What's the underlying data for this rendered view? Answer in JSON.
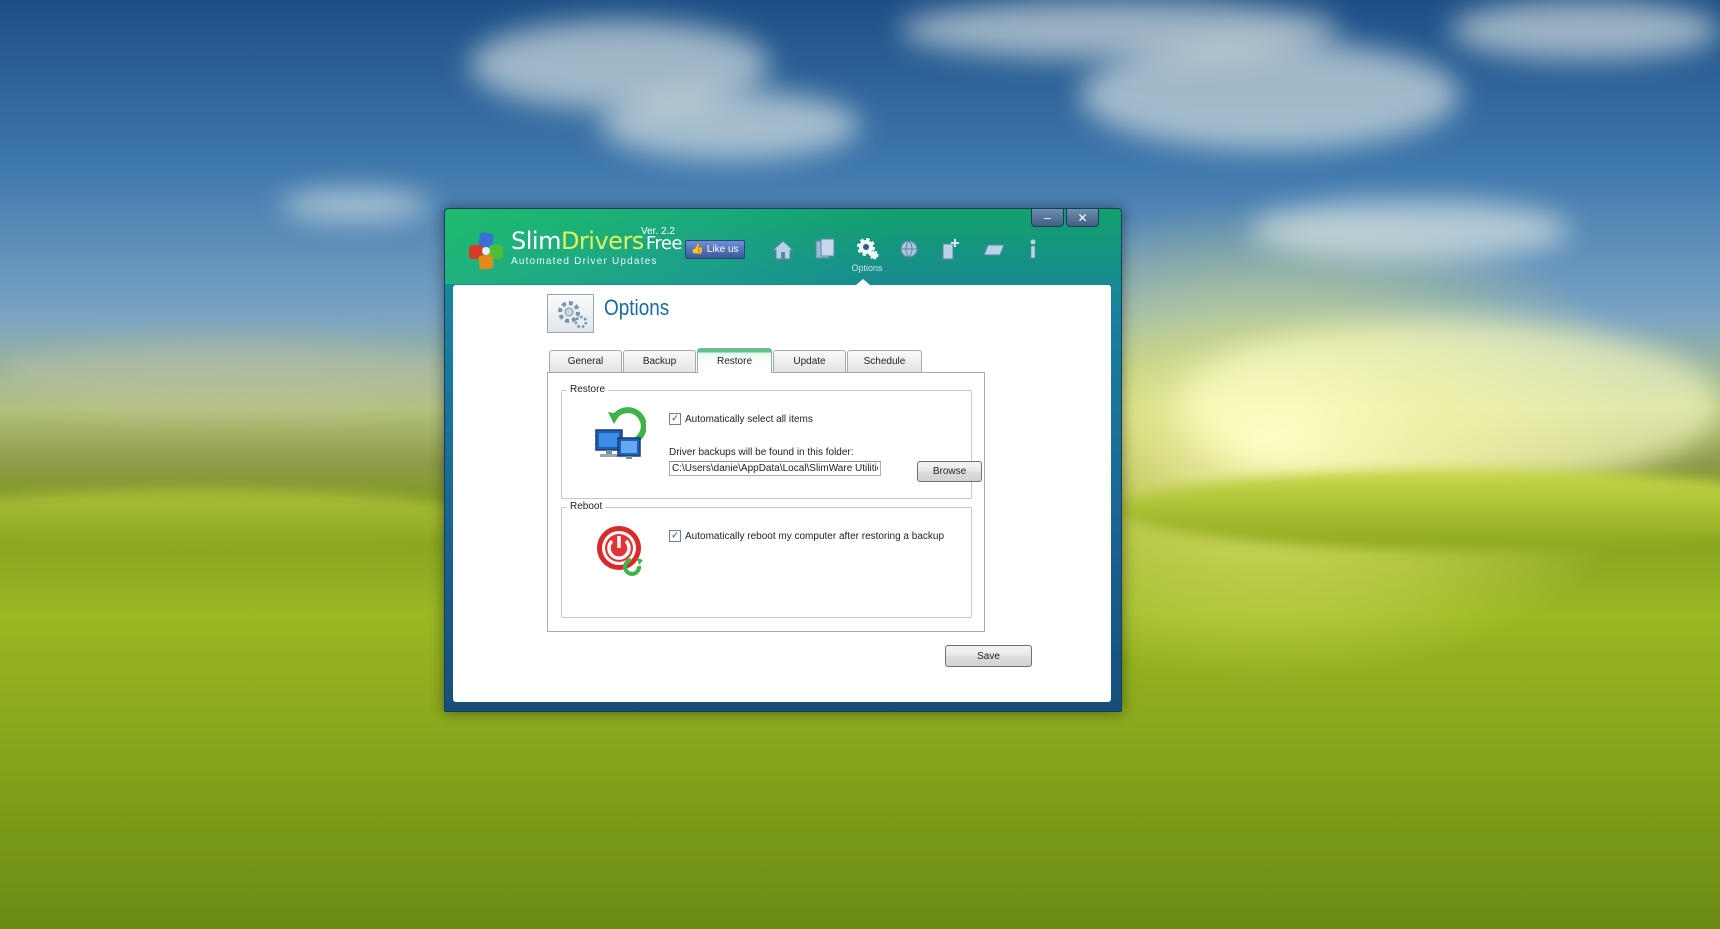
{
  "app": {
    "brand_slim": "Slim",
    "brand_drivers": "Drivers",
    "brand_free": "Free",
    "version": "Ver. 2.2",
    "tagline": "Automated Driver Updates",
    "like_label": "Like us",
    "window_controls": {
      "minimize": "‒",
      "close": "✕"
    }
  },
  "nav": {
    "items": [
      {
        "icon": "home-icon",
        "label": ""
      },
      {
        "icon": "scan-icon",
        "label": ""
      },
      {
        "icon": "gear-icon",
        "label": "Options",
        "active": true
      },
      {
        "icon": "globe-icon",
        "label": ""
      },
      {
        "icon": "backup-icon",
        "label": ""
      },
      {
        "icon": "restore-icon",
        "label": ""
      },
      {
        "icon": "info-icon",
        "label": ""
      }
    ]
  },
  "page": {
    "title": "Options"
  },
  "tabs": [
    {
      "label": "General",
      "active": false
    },
    {
      "label": "Backup",
      "active": false
    },
    {
      "label": "Restore",
      "active": true
    },
    {
      "label": "Update",
      "active": false
    },
    {
      "label": "Schedule",
      "active": false
    }
  ],
  "restore_group": {
    "legend": "Restore",
    "auto_select_label": "Automatically select all items",
    "auto_select_checked": true,
    "folder_label": "Driver backups will be found in this folder:",
    "folder_path": "C:\\Users\\danie\\AppData\\Local\\SlimWare Utilities Inc\\",
    "browse_label": "Browse"
  },
  "reboot_group": {
    "legend": "Reboot",
    "auto_reboot_label": "Automatically reboot my computer after restoring a backup",
    "auto_reboot_checked": true
  },
  "footer": {
    "save_label": "Save"
  },
  "colors": {
    "accent_green": "#59c58a",
    "title_blue": "#1d6a9c",
    "frame_blue": "#1b5f8e"
  }
}
